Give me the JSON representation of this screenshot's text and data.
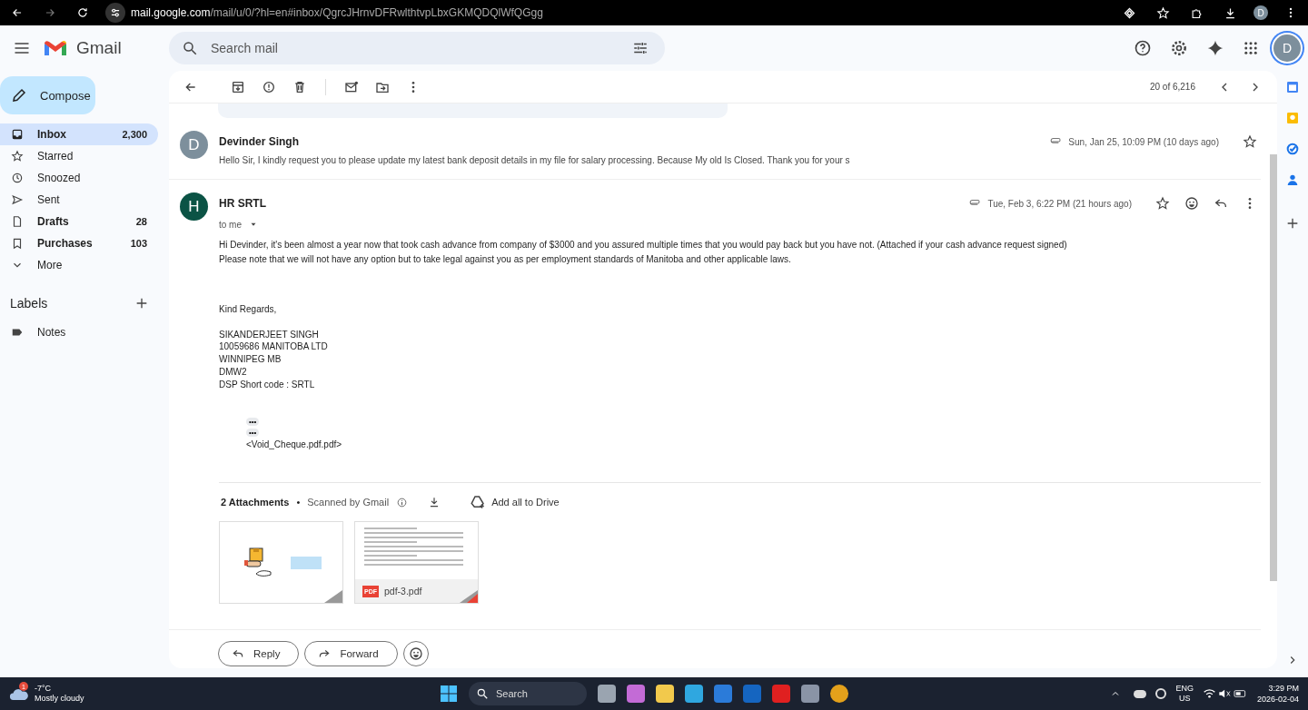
{
  "browser": {
    "url_host": "mail.google.com",
    "url_path": "/mail/u/0/?hl=en#inbox/QgrcJHrnvDFRwlthtvpLbxGKMQDQlWfQGgg",
    "profile": "D"
  },
  "header": {
    "app_name": "Gmail",
    "search_placeholder": "Search mail",
    "avatar": "D"
  },
  "compose": "Compose",
  "sidebar": {
    "items": [
      {
        "kind": "inbox",
        "label": "Inbox",
        "count": "2,300",
        "selected": true,
        "unread": true
      },
      {
        "kind": "star",
        "label": "Starred",
        "selected": false,
        "unread": false
      },
      {
        "kind": "clock",
        "label": "Snoozed",
        "selected": false,
        "unread": false
      },
      {
        "kind": "send",
        "label": "Sent",
        "selected": false,
        "unread": false
      },
      {
        "kind": "file",
        "label": "Drafts",
        "count": "28",
        "selected": false,
        "unread": true
      },
      {
        "kind": "tag",
        "label": "Purchases",
        "count": "103",
        "selected": false,
        "unread": true
      },
      {
        "kind": "chevron",
        "label": "More",
        "selected": false,
        "unread": false
      }
    ],
    "labels_title": "Labels",
    "labels": [
      {
        "label": "Notes"
      }
    ]
  },
  "toolbar": {
    "counter": "20 of 6,216"
  },
  "messages": [
    {
      "kind": "collapsed",
      "avatar": "D",
      "color": "#7d8f9c",
      "sender": "Devinder Singh",
      "snippet": "Hello Sir, I kindly request you to please update my latest bank deposit details in my file for salary processing. Because My old Is Closed. Thank you for your s",
      "date": "Sun, Jan 25, 10:09 PM (10 days ago)",
      "starred": false
    },
    {
      "kind": "expanded",
      "avatar": "H",
      "color": "#0b5345",
      "sender": "HR SRTL",
      "recipient": "to me",
      "date": "Tue, Feb 3, 6:22 PM (21 hours ago)",
      "starred": false,
      "paragraphs": [
        [
          "Hi Devinder, it's been almost a year now that took cash advance from company of $3000 and you assured multiple times that you would pay back but you have not. (Attached if your cash advance request signed)",
          "Please note that we will not have any option but to take legal against you as per employment standards of Manitoba and other applicable laws."
        ],
        [
          "Kind Regards,"
        ],
        [
          "SIKANDERJEET SINGH",
          "10059686 MANITOBA LTD",
          "WINNIPEG MB",
          "DMW2",
          "DSP Short code : SRTL"
        ]
      ],
      "quoted": [
        "•••",
        "•••"
      ],
      "quote_text": "<Void_Cheque.pdf.pdf>",
      "attachments": {
        "title": "2 Attachments",
        "separator": "•",
        "scanned": "Scanned by Gmail",
        "drive": "Add all to Drive",
        "items": [
          {
            "kind": "image"
          },
          {
            "kind": "pdf",
            "badge": "PDF",
            "name": "pdf-3.pdf"
          }
        ]
      }
    }
  ],
  "actions": [
    "Reply",
    "Forward"
  ],
  "taskbar": {
    "badge": "1",
    "temperature": "-7°C",
    "weather": "Mostly cloudy",
    "search": "Search",
    "lang": "ENG",
    "region": "US",
    "time": "3:29 PM",
    "date": "2026-02-04"
  }
}
